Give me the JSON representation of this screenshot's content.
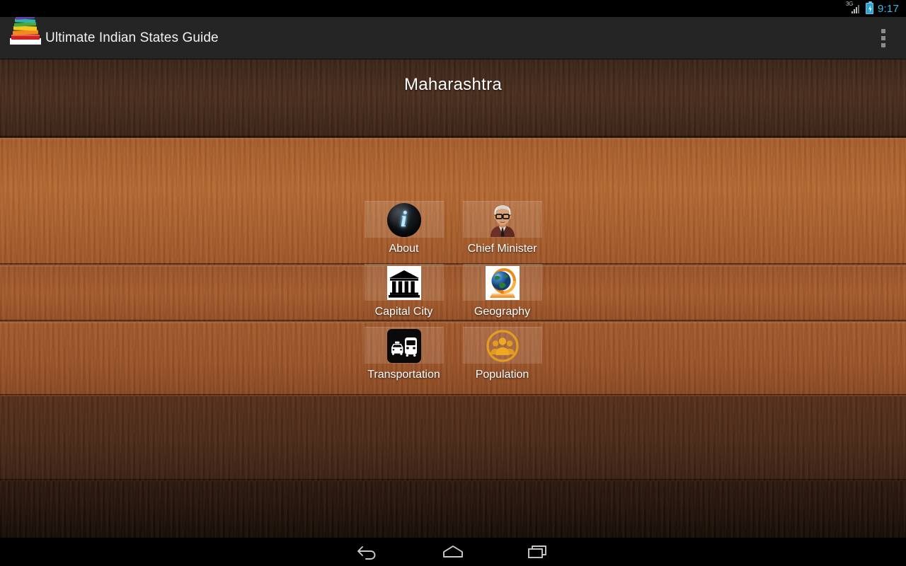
{
  "status_bar": {
    "network_label": "3G",
    "clock": "9:17",
    "battery_icon": "battery-charging-icon",
    "signal_icon": "signal-bars-icon",
    "clock_color": "#3fb8e8"
  },
  "action_bar": {
    "app_title": "Ultimate Indian States Guide",
    "logo_icon": "book-stack-icon",
    "overflow_icon": "overflow-menu-icon",
    "background_color": "#252525"
  },
  "main": {
    "state_title": "Maharashtra",
    "background": "wood-planks",
    "items": [
      {
        "label": "About",
        "icon": "info-sphere-icon"
      },
      {
        "label": "Chief Minister",
        "icon": "politician-portrait-icon"
      },
      {
        "label": "Capital City",
        "icon": "bank-building-icon"
      },
      {
        "label": "Geography",
        "icon": "globe-stand-icon"
      },
      {
        "label": "Transportation",
        "icon": "taxi-bus-icon"
      },
      {
        "label": "Population",
        "icon": "people-group-icon"
      }
    ]
  },
  "nav_bar": {
    "buttons": [
      {
        "name": "back",
        "icon": "back-arrow-icon"
      },
      {
        "name": "home",
        "icon": "home-icon"
      },
      {
        "name": "recents",
        "icon": "recent-apps-icon"
      }
    ]
  }
}
